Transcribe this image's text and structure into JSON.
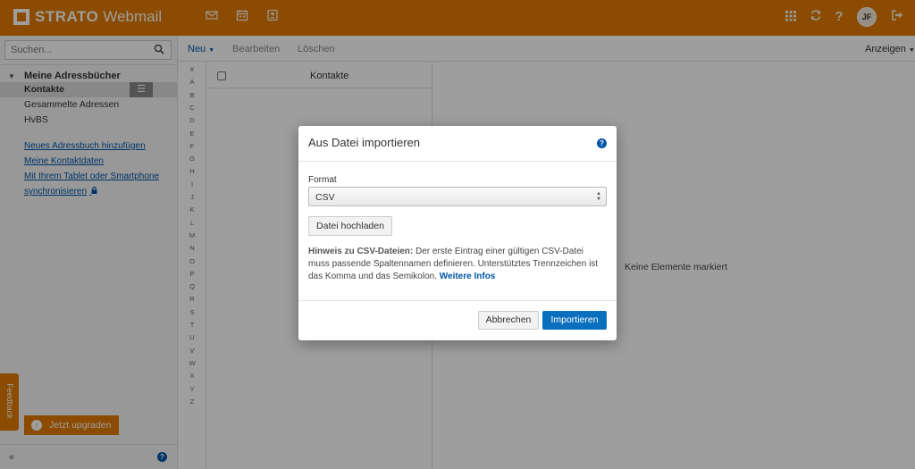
{
  "app": {
    "brand": "STRATO",
    "product": "Webmail",
    "brand_color": "#e07900",
    "avatar_initials": "JF"
  },
  "topbar": {
    "icons": [
      "mail-icon",
      "calendar-icon",
      "address-book-icon",
      "apps-grid-icon",
      "refresh-icon",
      "help-icon",
      "logout-icon"
    ]
  },
  "sidebar": {
    "search_placeholder": "Suchen...",
    "tree_header": "Meine Adressbücher",
    "items": [
      {
        "label": "Kontakte",
        "selected": true
      },
      {
        "label": "Gesammelte Adressen",
        "selected": false
      },
      {
        "label": "HvBS",
        "selected": false
      }
    ],
    "links": {
      "add_address_book": "Neues Adressbuch hinzufügen",
      "my_contact_data": "Meine Kontaktdaten",
      "sync_line1": "Mit Ihrem Tablet oder Smartphone",
      "sync_line2": "synchronisieren"
    },
    "upgrade_label": "Jetzt upgraden",
    "feedback_label": "Feedback",
    "collapse_label": "«"
  },
  "toolbar": {
    "new_label": "Neu",
    "edit_label": "Bearbeiten",
    "delete_label": "Löschen",
    "view_label": "Anzeigen"
  },
  "alphabet": [
    "#",
    "A",
    "B",
    "C",
    "D",
    "E",
    "F",
    "G",
    "H",
    "I",
    "J",
    "K",
    "L",
    "M",
    "N",
    "O",
    "P",
    "Q",
    "R",
    "S",
    "T",
    "U",
    "V",
    "W",
    "X",
    "Y",
    "Z"
  ],
  "list": {
    "title": "Kontakte"
  },
  "detail": {
    "empty_text": "Keine Elemente markiert"
  },
  "modal": {
    "title": "Aus Datei importieren",
    "format_label": "Format",
    "format_value": "CSV",
    "upload_label": "Datei hochladen",
    "hint_bold": "Hinweis zu CSV-Dateien:",
    "hint_text": " Der erste Eintrag einer gültigen CSV-Datei muss passende Spaltennamen definieren. Unterstütztes Trennzeichen ist das Komma und das Semikolon. ",
    "hint_link": "Weitere Infos",
    "cancel_label": "Abbrechen",
    "import_label": "Importieren"
  }
}
